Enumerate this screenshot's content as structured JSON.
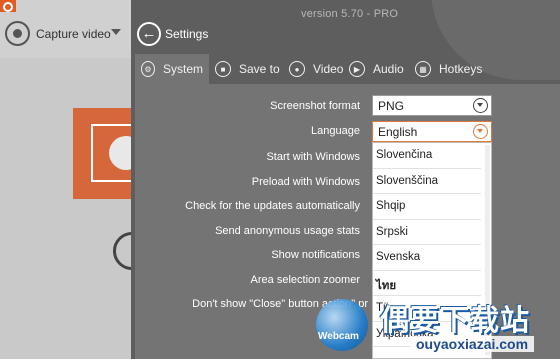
{
  "app": {
    "capture_label": "Capture video"
  },
  "settings": {
    "version": "version 5.70 - PRO",
    "title": "Settings",
    "tabs": [
      {
        "label": "System",
        "icon": "system-icon"
      },
      {
        "label": "Save to",
        "icon": "folder-icon"
      },
      {
        "label": "Video",
        "icon": "record-icon"
      },
      {
        "label": "Audio",
        "icon": "speaker-icon"
      },
      {
        "label": "Hotkeys",
        "icon": "keyboard-icon"
      }
    ],
    "labels": [
      "Screenshot format",
      "Language",
      "Start with Windows",
      "Preload with Windows",
      "Check for the updates automatically",
      "Send anonymous usage stats",
      "Show notifications",
      "Area selection zoomer",
      "Don't show \"Close\" button action\" pr"
    ],
    "screenshot_format": "PNG",
    "language": "English",
    "language_options": [
      "Slovenčina",
      "Slovenščina",
      "Shqip",
      "Srpski",
      "Svenska",
      "ไทย",
      "Tü",
      "Українська"
    ]
  },
  "watermark": {
    "cn": "偶要下载站",
    "url": "ouyaoxiazai.com",
    "logo_text": "Webcam"
  },
  "colors": {
    "accent": "#e07a3a",
    "brand": "#e05c23"
  }
}
